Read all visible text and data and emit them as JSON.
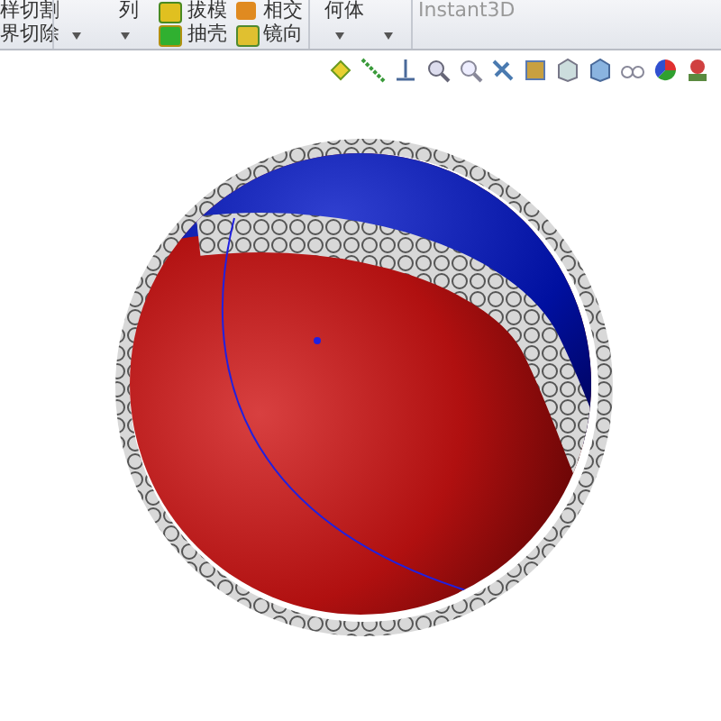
{
  "ribbon": {
    "groups": [
      {
        "items": [
          {
            "label": "样切割"
          },
          {
            "label": "界切除"
          }
        ]
      },
      {
        "items": [
          {
            "label": "列"
          }
        ]
      },
      {
        "items": [
          {
            "label": "拔模"
          },
          {
            "label": "抽壳"
          }
        ]
      },
      {
        "items": [
          {
            "label": "相交"
          },
          {
            "label": "镜向"
          }
        ]
      },
      {
        "items": [
          {
            "label": "何体"
          }
        ]
      },
      {
        "items": [
          {
            "label": "Instant3D"
          }
        ]
      }
    ]
  }
}
